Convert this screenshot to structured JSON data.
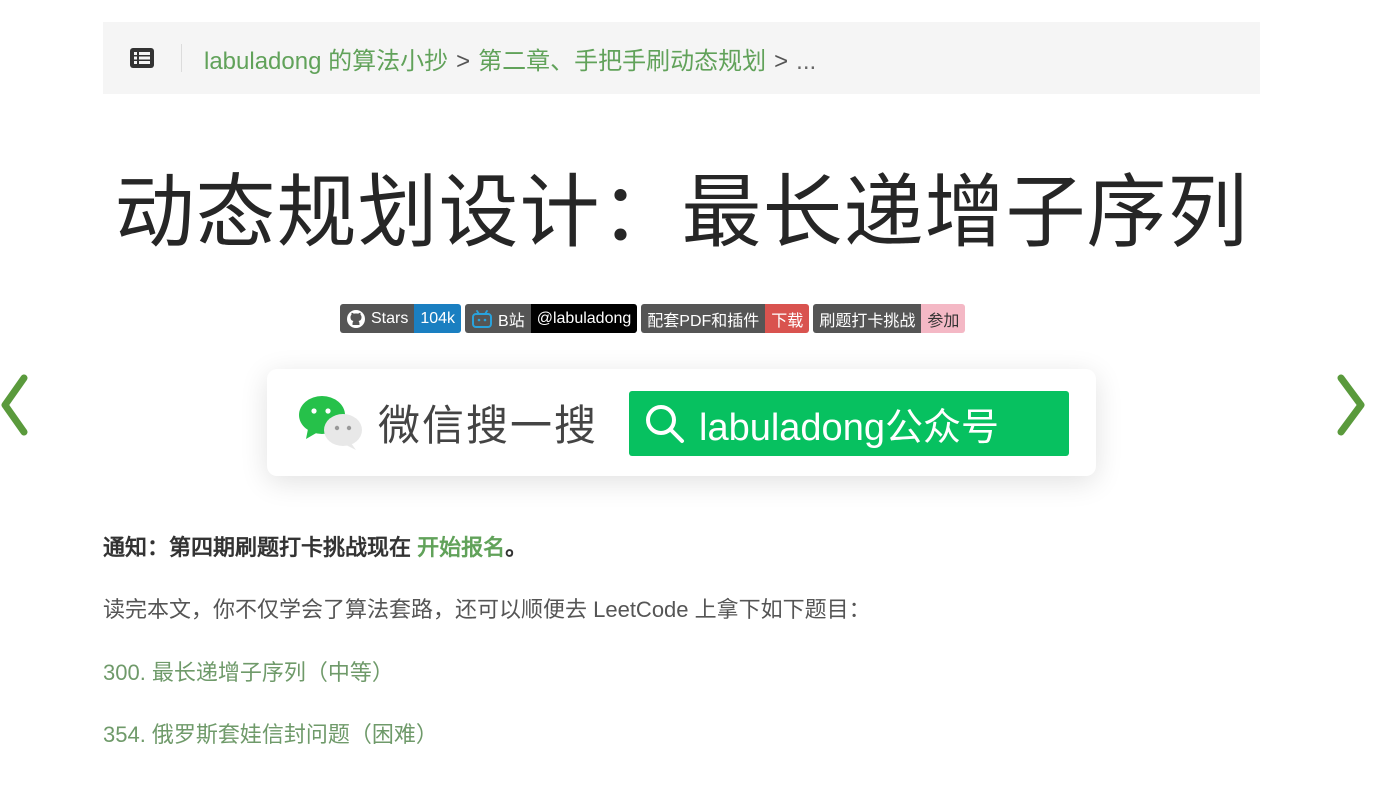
{
  "breadcrumb": {
    "items": [
      "labuladong 的算法小抄",
      "第二章、手把手刷动态规划"
    ],
    "separator": ">",
    "ellipsis": "..."
  },
  "page_title": "动态规划设计：最长递增子序列",
  "badges": [
    {
      "left": "Stars",
      "right": "104k",
      "right_color": "#1a7fc1",
      "icon": "github-icon"
    },
    {
      "left": "B站",
      "right": "@labuladong",
      "right_color": "#000000",
      "icon": "bilibili-icon"
    },
    {
      "left": "配套PDF和插件",
      "right": "下载",
      "right_color": "#d9534f"
    },
    {
      "left": "刷题打卡挑战",
      "right": "参加",
      "right_color": "#f4b8c5"
    }
  ],
  "wechat": {
    "text": "微信搜一搜",
    "button": "labuladong公众号"
  },
  "notice": {
    "prefix": "通知：第四期刷题打卡挑战现在",
    "link": "开始报名",
    "suffix": "。"
  },
  "intro": "读完本文，你不仅学会了算法套路，还可以顺便去 LeetCode 上拿下如下题目：",
  "problems": [
    "300. 最长递增子序列（中等）",
    "354. 俄罗斯套娃信封问题（困难）"
  ],
  "colors": {
    "accent": "#61a25a",
    "wechat_green": "#07c160",
    "arrow": "#5a9a3c"
  }
}
